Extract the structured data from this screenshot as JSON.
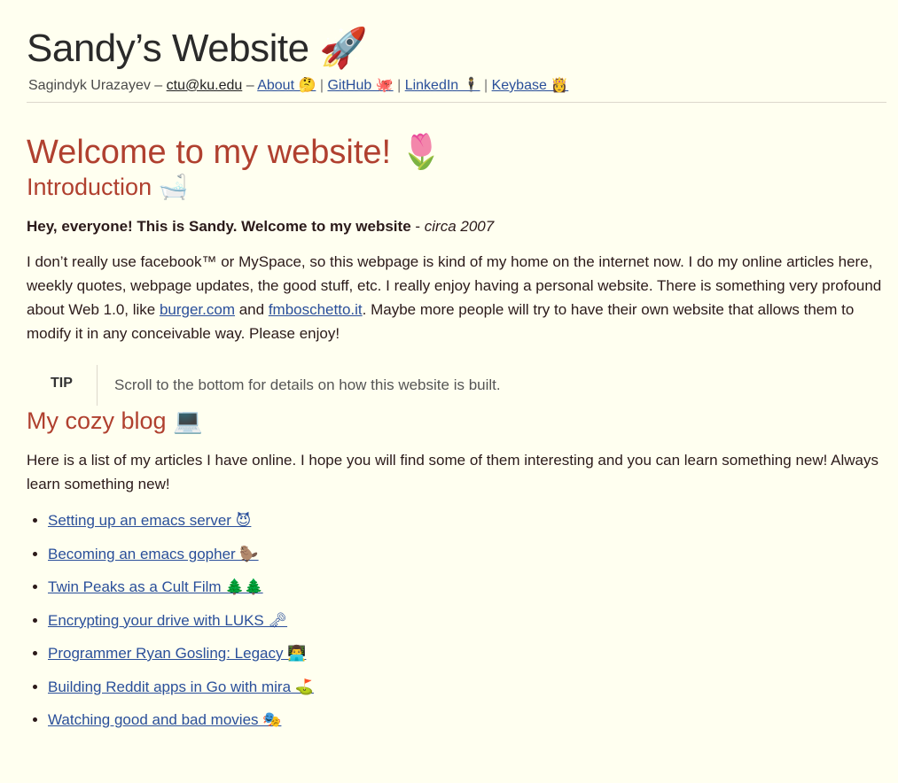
{
  "header": {
    "title": "Sandy’s Website 🚀",
    "author": "Sagindyk Urazayev",
    "dash1": "–",
    "email": "ctu@ku.edu",
    "dash2": "–",
    "links": [
      {
        "label": "About 🤔"
      },
      {
        "label": "GitHub 🐙"
      },
      {
        "label": "LinkedIn 🕴"
      },
      {
        "label": "Keybase 👸"
      }
    ],
    "separator": "|"
  },
  "main": {
    "welcome": "Welcome to my website! 🌷",
    "intro": {
      "heading": "Introduction 🛁",
      "lead_bold": "Hey, everyone! This is Sandy. Welcome to my website",
      "lead_dash": " - ",
      "lead_italic": "circa 2007",
      "para_before": "I don’t really use facebook™ or MySpace, so this webpage is kind of my home on the internet now. I do my online articles here, weekly quotes, webpage updates, the good stuff, etc. I really enjoy having a personal website. There is something very profound about Web 1.0, like ",
      "link1": "burger.com",
      "para_and": " and ",
      "link2": "fmboschetto.it",
      "para_after": ". Maybe more people will try to have their own website that allows them to modify it in any conceivable way. Please enjoy!"
    },
    "tip": {
      "label": "TIP",
      "text": "Scroll to the bottom for details on how this website is built."
    },
    "blog": {
      "heading": "My cozy blog 💻",
      "intro": "Here is a list of my articles I have online. I hope you will find some of them interesting and you can learn something new! Always learn something new!",
      "articles": [
        "Setting up an emacs server 😈",
        "Becoming an emacs gopher 🦫",
        "Twin Peaks as a Cult Film 🌲🌲",
        "Encrypting your drive with LUKS 🗝",
        "Programmer Ryan Gosling: Legacy 👨‍💻",
        "Building Reddit apps in Go with mira ⛳",
        "Watching good and bad movies 🎭"
      ]
    }
  },
  "colors": {
    "background": "#fffff0",
    "heading": "#b0402f",
    "link": "#2a4f9a",
    "text": "#2b1a1a"
  }
}
